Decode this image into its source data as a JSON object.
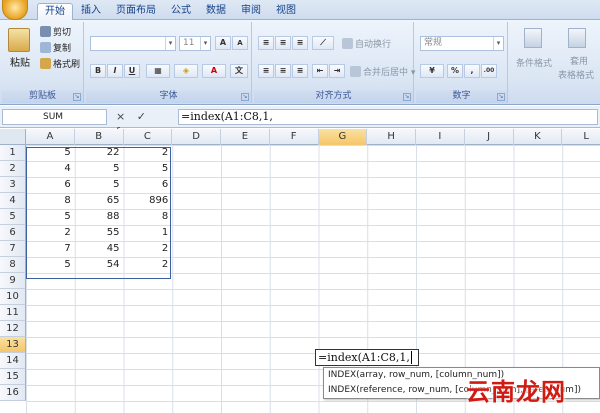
{
  "tabs": [
    "开始",
    "插入",
    "页面布局",
    "公式",
    "数据",
    "审阅",
    "视图"
  ],
  "ribbon": {
    "clipboard": {
      "paste": "粘贴",
      "cut": "剪切",
      "copy": "复制",
      "format_painter": "格式刷",
      "label": "剪贴板"
    },
    "font": {
      "size": "11",
      "bold": "B",
      "italic": "I",
      "underline": "U",
      "grow": "A",
      "shrink": "A",
      "label": "字体"
    },
    "alignment": {
      "wrap_text": "自动换行",
      "merge_center": "合并后居中",
      "label": "对齐方式"
    },
    "number": {
      "format": "常规",
      "label": "数字"
    },
    "styles": {
      "conditional_format": "条件格式",
      "table_format_1": "套用",
      "table_format_2": "表格格式"
    }
  },
  "formula_bar": {
    "name_box": "SUM",
    "buttons": "× ✓ fx",
    "formula": "=index(A1:C8,1,"
  },
  "columns": [
    "A",
    "B",
    "C",
    "D",
    "E",
    "F",
    "G",
    "H",
    "I",
    "J",
    "K",
    "L"
  ],
  "rows": [
    "1",
    "2",
    "3",
    "4",
    "5",
    "6",
    "7",
    "8",
    "9",
    "10",
    "11",
    "12",
    "13",
    "14",
    "15",
    "16"
  ],
  "table": [
    [
      "5",
      "22",
      "2"
    ],
    [
      "4",
      "5",
      "5"
    ],
    [
      "6",
      "5",
      "6"
    ],
    [
      "8",
      "65",
      "896"
    ],
    [
      "5",
      "88",
      "8"
    ],
    [
      "2",
      "55",
      "1"
    ],
    [
      "7",
      "45",
      "2"
    ],
    [
      "5",
      "54",
      "2"
    ]
  ],
  "edit_cell": "=index(A1:C8,1,",
  "tooltip": {
    "line1": "INDEX(array, row_num, [column_num])",
    "line2": "INDEX(reference, row_num, [column_num], [area_num])"
  },
  "watermark": "云南龙网",
  "colors": {
    "accent": "#f4c66a",
    "ribbon": "#dbe6f4",
    "watermark": "#d01a12"
  }
}
